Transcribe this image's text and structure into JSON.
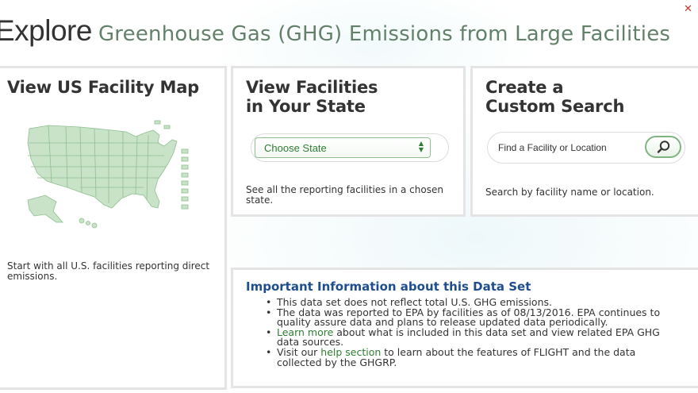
{
  "header": {
    "explore": "Explore",
    "subtitle": "Greenhouse Gas (GHG) Emissions from Large Facilities"
  },
  "map_card": {
    "heading": "View US Facility Map",
    "description": "Start with all U.S. facilities reporting direct emissions."
  },
  "state_card": {
    "heading": "View Facilities\nin Your State",
    "select_value": "Choose State",
    "description": "See all the reporting facilities in a chosen state."
  },
  "search_card": {
    "heading": "Create a\nCustom Search",
    "placeholder": "Find a Facility or Location",
    "description": "Search by facility name or location."
  },
  "info": {
    "heading": "Important Information about this Data Set",
    "bullet1": "This data set does not reflect total U.S. GHG emissions.",
    "bullet2": "The data was reported to EPA by facilities as of 08/13/2016. EPA continues to quality assure data and plans to release updated data periodically.",
    "bullet3_link": "Learn more",
    "bullet3_text": " about what is included in this data set and view related EPA GHG data sources.",
    "bullet4_prefix": "Visit our ",
    "bullet4_link": "help section",
    "bullet4_text": " to learn about the features of FLIGHT and the data collected by the GHGRP."
  },
  "colors": {
    "accent_green": "#2e7d32",
    "subtitle_green": "#63816a",
    "info_blue": "#1f4e8c",
    "map_fill": "#c9e3c9"
  },
  "icons": {
    "search": "magnifier-icon",
    "select": "updown-arrows-icon",
    "corner": "close-mark-icon"
  }
}
